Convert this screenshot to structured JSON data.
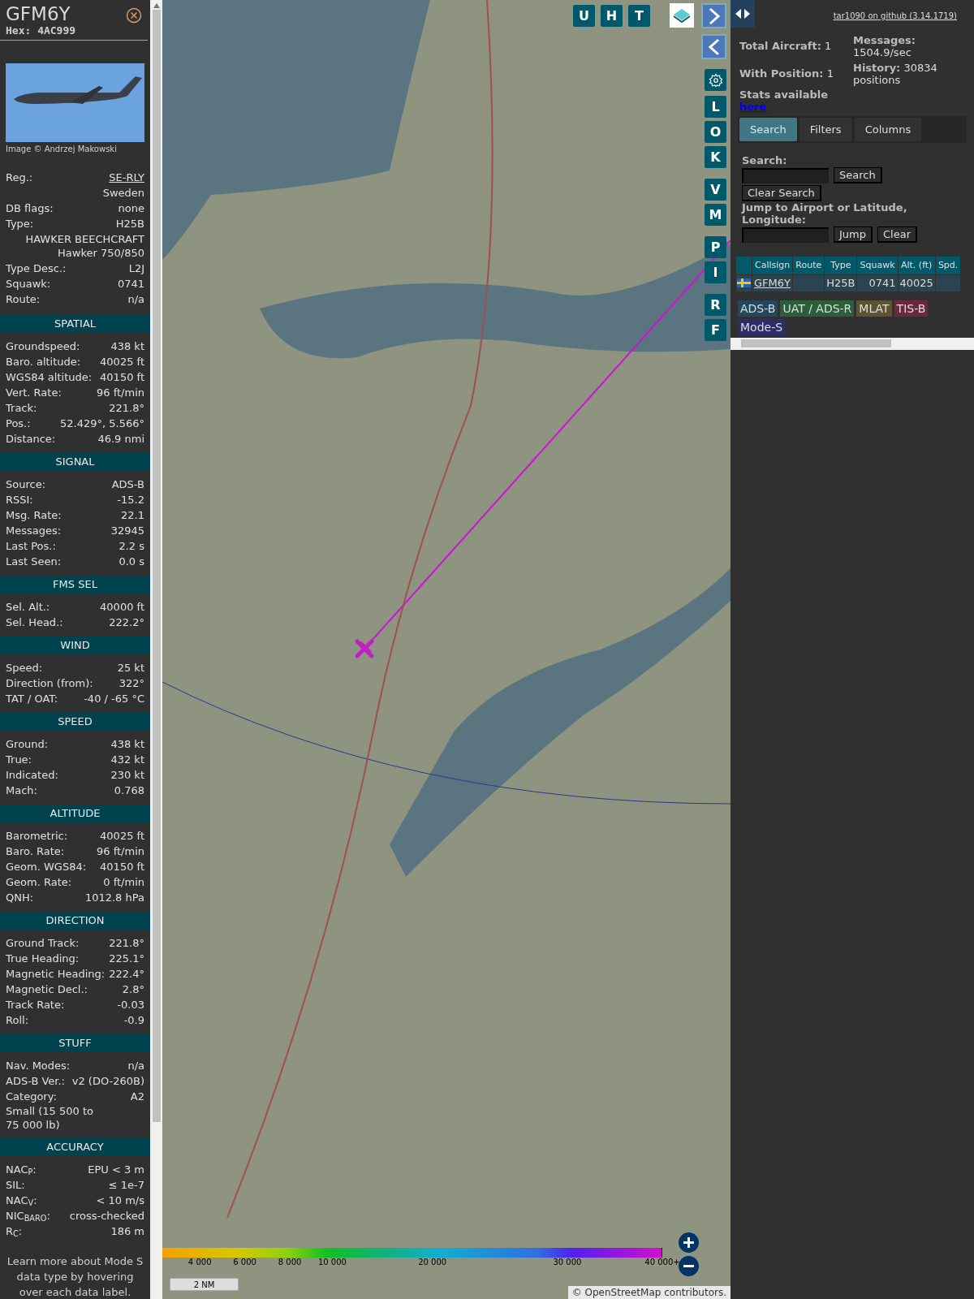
{
  "aircraft": {
    "callsign": "GFM6Y",
    "hex": "Hex: 4AC999",
    "photo_credit": "Image © Andrzej Makowski",
    "info": [
      {
        "label": "Reg.:",
        "value": "SE-RLY",
        "kind": "link"
      },
      {
        "value": "Sweden",
        "kind": "plain"
      },
      {
        "label": "DB flags:",
        "value": "none",
        "kind": "plain"
      },
      {
        "label": "Type:",
        "value": "H25B",
        "kind": "plain"
      },
      {
        "value": "HAWKER BEECHCRAFT\nHawker 750/850",
        "kind": "plain"
      },
      {
        "label": "Type Desc.:",
        "value": "L2J",
        "kind": "plain"
      },
      {
        "label": "Squawk:",
        "value": "0741",
        "kind": "plain"
      },
      {
        "label": "Route:",
        "value": "n/a",
        "kind": "plain"
      }
    ],
    "sections": [
      {
        "title": "SPATIAL",
        "rows": [
          [
            "Groundspeed:",
            "438 kt"
          ],
          [
            "Baro. altitude:",
            "40025 ft"
          ],
          [
            "WGS84 altitude:",
            "40150 ft"
          ],
          [
            "Vert. Rate:",
            "96 ft/min"
          ],
          [
            "Track:",
            "221.8°"
          ],
          [
            "Pos.:",
            "52.429°, 5.566°"
          ],
          [
            "Distance:",
            "46.9 nmi"
          ]
        ]
      },
      {
        "title": "SIGNAL",
        "rows": [
          [
            "Source:",
            "ADS-B"
          ],
          [
            "RSSI:",
            "-15.2"
          ],
          [
            "Msg. Rate:",
            "22.1"
          ],
          [
            "Messages:",
            "32945"
          ],
          [
            "Last Pos.:",
            "2.2 s"
          ],
          [
            "Last Seen:",
            "0.0 s"
          ]
        ]
      },
      {
        "title": "FMS SEL",
        "rows": [
          [
            "Sel. Alt.:",
            "40000 ft"
          ],
          [
            "Sel. Head.:",
            "222.2°"
          ]
        ]
      },
      {
        "title": "WIND",
        "rows": [
          [
            "Speed:",
            "25 kt"
          ],
          [
            "Direction (from):",
            "322°"
          ],
          [
            "TAT / OAT:",
            "-40 / -65 °C"
          ]
        ]
      },
      {
        "title": "SPEED",
        "rows": [
          [
            "Ground:",
            "438 kt"
          ],
          [
            "True:",
            "432 kt"
          ],
          [
            "Indicated:",
            "230 kt"
          ],
          [
            "Mach:",
            "0.768"
          ]
        ]
      },
      {
        "title": "ALTITUDE",
        "rows": [
          [
            "Barometric:",
            "40025 ft"
          ],
          [
            "Baro. Rate:",
            "96 ft/min"
          ],
          [
            "Geom. WGS84:",
            "40150 ft"
          ],
          [
            "Geom. Rate:",
            "0 ft/min"
          ],
          [
            "QNH:",
            "1012.8 hPa"
          ]
        ]
      },
      {
        "title": "DIRECTION",
        "rows": [
          [
            "Ground Track:",
            "221.8°"
          ],
          [
            "True Heading:",
            "225.1°"
          ],
          [
            "Magnetic Heading:",
            "222.4°"
          ],
          [
            "Magnetic Decl.:",
            "2.8°"
          ],
          [
            "Track Rate:",
            "-0.03"
          ],
          [
            "Roll:",
            "-0.9"
          ]
        ]
      },
      {
        "title": "STUFF",
        "rows": [
          [
            "Nav. Modes:",
            "n/a"
          ],
          [
            "ADS-B Ver.:",
            "v2 (DO-260B)"
          ],
          [
            "Category:",
            "A2"
          ]
        ],
        "note": "Small (15 500 to 75 000 lb)"
      },
      {
        "title": "ACCURACY",
        "rows": [
          [
            "NAC$_{P}$:",
            "EPU < 3 m"
          ],
          [
            "SIL:",
            "≤ 1e-7"
          ],
          [
            "NAC$_{V}$:",
            "< 10 m/s"
          ],
          [
            "NIC$_{BARO}$:",
            "cross-checked"
          ],
          [
            "R$_{C}$:",
            "186 m"
          ]
        ]
      }
    ],
    "footer": "Learn more about Mode S data type by hovering over each data label."
  },
  "map": {
    "top_buttons": [
      "U",
      "H",
      "T"
    ],
    "side_buttons": [
      "L",
      "O",
      "K",
      "V",
      "M",
      "P",
      "I",
      "R",
      "F"
    ],
    "altitude_labels": [
      "4 000",
      "6 000",
      "8 000",
      "10 000",
      "20 000",
      "30 000",
      "40 000+"
    ],
    "scale": "2 NM",
    "attribution": "© OpenStreetMap contributors."
  },
  "panel": {
    "github_link": "tar1090 on github (3.14.1719)",
    "stats": [
      {
        "label": "Total Aircraft:",
        "value": "1"
      },
      {
        "label": "Messages:",
        "value": "1504.9/sec"
      },
      {
        "label": "With Position:",
        "value": "1"
      },
      {
        "label": "History:",
        "value": "30834 positions"
      }
    ],
    "stats_text": "Stats available",
    "stats_link": "here",
    "tabs": [
      {
        "label": "Search",
        "selected": true
      },
      {
        "label": "Filters",
        "selected": false
      },
      {
        "label": "Columns",
        "selected": false
      }
    ],
    "search_label": "Search:",
    "search_button": "Search",
    "clear_search_button": "Clear Search",
    "jump_label": "Jump to Airport or Latitude, Longitude:",
    "jump_button": "Jump",
    "clear_button": "Clear",
    "table": {
      "columns": [
        "Callsign",
        "Route",
        "Type",
        "Squawk",
        "Alt. (ft)",
        "Spd."
      ],
      "rows": [
        {
          "callsign": "GFM6Y",
          "route": "",
          "type": "H25B",
          "squawk": "0741",
          "alt": "40025",
          "spd": ""
        }
      ]
    },
    "legend": [
      {
        "label": "ADS-B",
        "color": "#23475e"
      },
      {
        "label": "UAT / ADS-R",
        "color": "#2b5f3a"
      },
      {
        "label": "MLAT",
        "color": "#5c5431"
      },
      {
        "label": "TIS-B",
        "color": "#6b2a3c"
      },
      {
        "label": "Mode-S",
        "color": "#2d2d6b"
      }
    ]
  }
}
